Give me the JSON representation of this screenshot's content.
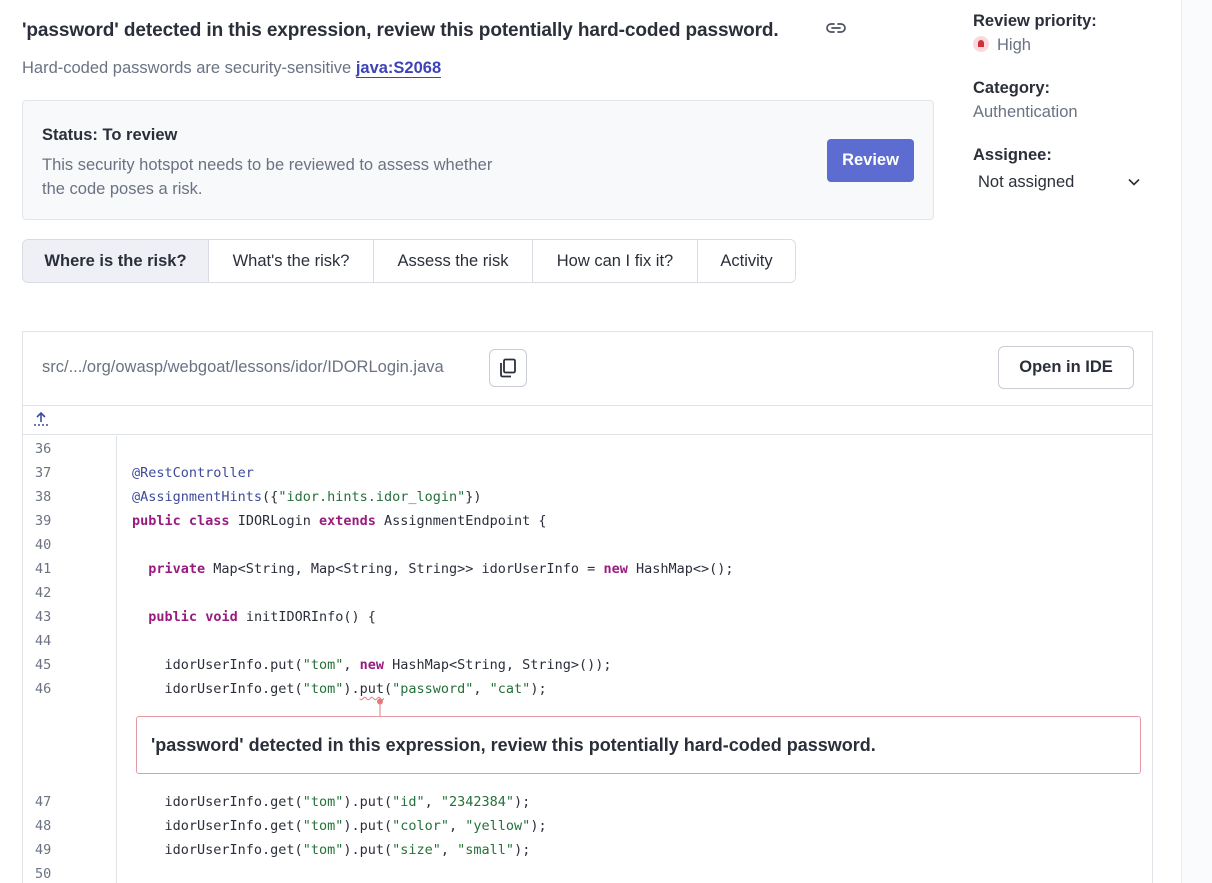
{
  "hotspot": {
    "title": "'password' detected in this expression, review this potentially hard-coded password.",
    "subtitle_text": "Hard-coded passwords are security-sensitive ",
    "rule_key": "java:S2068",
    "link_icon": "link-icon"
  },
  "status": {
    "title": "Status: To review",
    "description": "This security hotspot needs to be reviewed to assess whether the code poses a risk.",
    "review_label": "Review"
  },
  "tabs": [
    {
      "label": "Where is the risk?",
      "active": true
    },
    {
      "label": "What's the risk?",
      "active": false
    },
    {
      "label": "Assess the risk",
      "active": false
    },
    {
      "label": "How can I fix it?",
      "active": false
    },
    {
      "label": "Activity",
      "active": false
    }
  ],
  "sidebar": {
    "review_priority_label": "Review priority:",
    "review_priority_value": "High",
    "category_label": "Category:",
    "category_value": "Authentication",
    "assignee_label": "Assignee:",
    "assignee_value": "Not assigned"
  },
  "code_viewer": {
    "file_path": "src/.../org/owasp/webgoat/lessons/idor/IDORLogin.java",
    "open_in_ide_label": "Open in IDE",
    "copy_icon": "copy-icon",
    "expand_icon": "expand-up-icon",
    "issue_message": "'password' detected in this expression, review this potentially hard-coded password.",
    "lines": [
      {
        "number": "36",
        "code": ""
      },
      {
        "number": "37",
        "code": "@RestController"
      },
      {
        "number": "38",
        "code": "@AssignmentHints({\"idor.hints.idor_login\"})"
      },
      {
        "number": "39",
        "code": "public class IDORLogin extends AssignmentEndpoint {"
      },
      {
        "number": "40",
        "code": ""
      },
      {
        "number": "41",
        "code": "  private Map<String, Map<String, String>> idorUserInfo = new HashMap<>();"
      },
      {
        "number": "42",
        "code": ""
      },
      {
        "number": "43",
        "code": "  public void initIDORInfo() {"
      },
      {
        "number": "44",
        "code": ""
      },
      {
        "number": "45",
        "code": "    idorUserInfo.put(\"tom\", new HashMap<String, String>());"
      },
      {
        "number": "46",
        "code": "    idorUserInfo.get(\"tom\").put(\"password\", \"cat\");"
      },
      {
        "number": "47",
        "code": "    idorUserInfo.get(\"tom\").put(\"id\", \"2342384\");"
      },
      {
        "number": "48",
        "code": "    idorUserInfo.get(\"tom\").put(\"color\", \"yellow\");"
      },
      {
        "number": "49",
        "code": "    idorUserInfo.get(\"tom\").put(\"size\", \"small\");"
      },
      {
        "number": "50",
        "code": ""
      }
    ]
  },
  "colors": {
    "accent": "#5d6cd0",
    "rule_link": "#3e43b5",
    "priority_high": "#d02f3a",
    "issue_border": "#e59aa1"
  }
}
